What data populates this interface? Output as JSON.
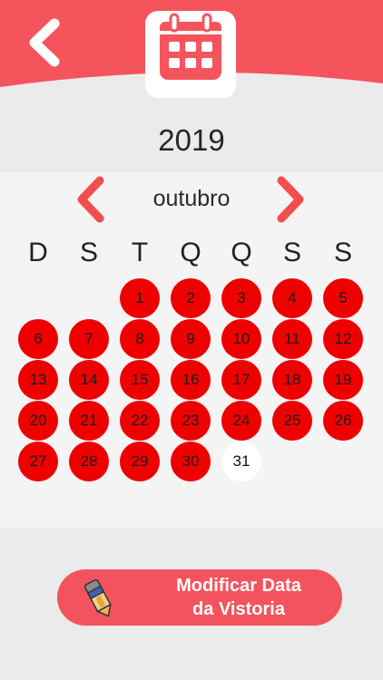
{
  "colors": {
    "header": "#f5545c",
    "booked_day": "#ef0000",
    "free_day": "#ffffff",
    "button": "#f3535c",
    "background": "#ebebeb",
    "panel": "#f4f4f4"
  },
  "header": {
    "back_icon": "chevron-left-icon",
    "badge_icon": "calendar-icon"
  },
  "calendar": {
    "year": "2019",
    "month": "outubro",
    "prev_icon": "chevron-left-icon",
    "next_icon": "chevron-right-icon",
    "weekdays": [
      "D",
      "S",
      "T",
      "Q",
      "Q",
      "S",
      "S"
    ],
    "first_weekday_index": 2,
    "days": [
      {
        "n": "1",
        "state": "booked"
      },
      {
        "n": "2",
        "state": "booked"
      },
      {
        "n": "3",
        "state": "booked"
      },
      {
        "n": "4",
        "state": "booked"
      },
      {
        "n": "5",
        "state": "booked"
      },
      {
        "n": "6",
        "state": "booked"
      },
      {
        "n": "7",
        "state": "booked"
      },
      {
        "n": "8",
        "state": "booked"
      },
      {
        "n": "9",
        "state": "booked"
      },
      {
        "n": "10",
        "state": "booked"
      },
      {
        "n": "11",
        "state": "booked"
      },
      {
        "n": "12",
        "state": "booked"
      },
      {
        "n": "13",
        "state": "booked"
      },
      {
        "n": "14",
        "state": "booked"
      },
      {
        "n": "15",
        "state": "booked"
      },
      {
        "n": "16",
        "state": "booked"
      },
      {
        "n": "17",
        "state": "booked"
      },
      {
        "n": "18",
        "state": "booked"
      },
      {
        "n": "19",
        "state": "booked"
      },
      {
        "n": "20",
        "state": "booked"
      },
      {
        "n": "21",
        "state": "booked"
      },
      {
        "n": "22",
        "state": "booked"
      },
      {
        "n": "23",
        "state": "booked"
      },
      {
        "n": "24",
        "state": "booked"
      },
      {
        "n": "25",
        "state": "booked"
      },
      {
        "n": "26",
        "state": "booked"
      },
      {
        "n": "27",
        "state": "booked"
      },
      {
        "n": "28",
        "state": "booked"
      },
      {
        "n": "29",
        "state": "booked"
      },
      {
        "n": "30",
        "state": "booked"
      },
      {
        "n": "31",
        "state": "free"
      }
    ]
  },
  "action": {
    "icon": "pencil-eraser-icon",
    "line1": "Modificar Data",
    "line2": "da Vistoria"
  }
}
